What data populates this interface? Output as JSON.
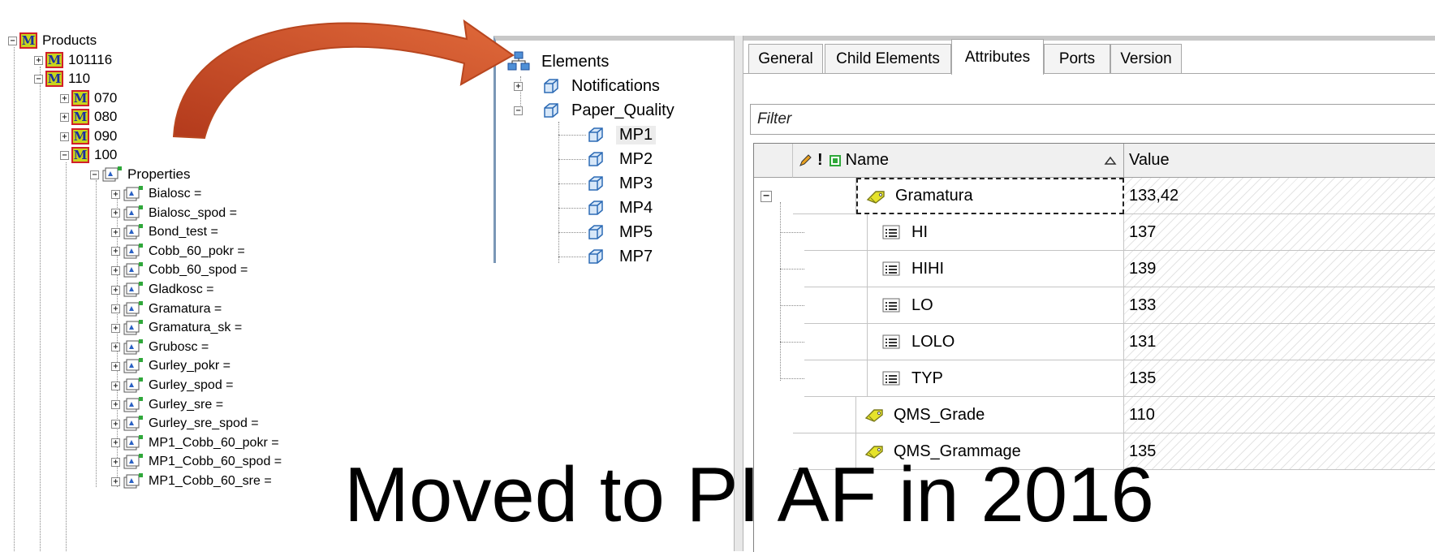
{
  "left_tree": {
    "root": "Products",
    "nodes": [
      "101116",
      "110",
      "070",
      "080",
      "090",
      "100"
    ],
    "properties_label": "Properties",
    "properties": [
      "Bialosc =",
      "Bialosc_spod =",
      "Bond_test =",
      "Cobb_60_pokr =",
      "Cobb_60_spod =",
      "Gladkosc =",
      "Gramatura =",
      "Gramatura_sk =",
      "Grubosc =",
      "Gurley_pokr =",
      "Gurley_spod =",
      "Gurley_sre =",
      "Gurley_sre_spod =",
      "MP1_Cobb_60_pokr =",
      "MP1_Cobb_60_spod =",
      "MP1_Cobb_60_sre ="
    ],
    "expander_plus": "+",
    "expander_minus": "−",
    "model_icon_letter": "M"
  },
  "elements_panel": {
    "root": "Elements",
    "groups": [
      "Notifications",
      "Paper_Quality"
    ],
    "items": [
      "MP1",
      "MP2",
      "MP3",
      "MP4",
      "MP5",
      "MP7"
    ],
    "selected": "MP1"
  },
  "attributes_panel": {
    "tabs": [
      "General",
      "Child Elements",
      "Attributes",
      "Ports",
      "Version"
    ],
    "active_tab": "Attributes",
    "filter_placeholder": "Filter",
    "columns": {
      "name": "Name",
      "value": "Value"
    },
    "collapse_glyph": "−",
    "rows": [
      {
        "name": "Gramatura",
        "value": "133,42",
        "icon": "tag-icon",
        "level": 0
      },
      {
        "name": "HI",
        "value": "137",
        "icon": "list-icon",
        "level": 1
      },
      {
        "name": "HIHI",
        "value": "139",
        "icon": "list-icon",
        "level": 1
      },
      {
        "name": "LO",
        "value": "133",
        "icon": "list-icon",
        "level": 1
      },
      {
        "name": "LOLO",
        "value": "131",
        "icon": "list-icon",
        "level": 1
      },
      {
        "name": "TYP",
        "value": "135",
        "icon": "list-icon",
        "level": 1
      },
      {
        "name": "QMS_Grade",
        "value": "110",
        "icon": "tag-icon",
        "level": 0
      },
      {
        "name": "QMS_Grammage",
        "value": "135",
        "icon": "tag-icon",
        "level": 0
      }
    ]
  },
  "slide_title": "Moved to PI AF in 2016",
  "colors": {
    "arrow": "#d2552a",
    "model_icon_bg": "#c8d41c",
    "model_icon_border": "#d1202a",
    "cube": "#3e7ec4"
  }
}
